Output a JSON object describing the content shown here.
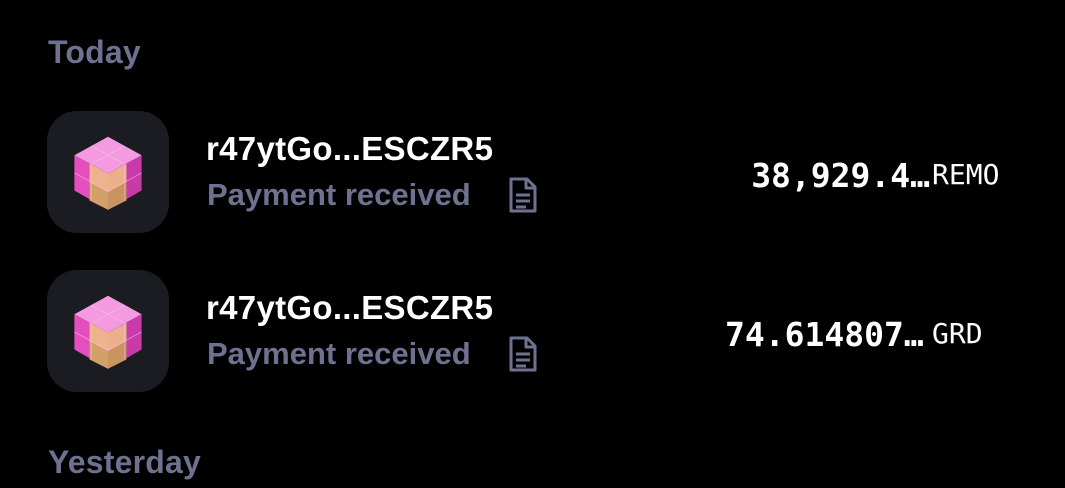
{
  "sections": {
    "today": "Today",
    "yesterday": "Yesterday"
  },
  "transactions": [
    {
      "address": "r47ytGo...ESCZR5",
      "status": "Payment received",
      "amount": "38,929.4…",
      "currency": "REMO",
      "icon": "pink-cube-token-icon"
    },
    {
      "address": "r47ytGo...ESCZR5",
      "status": "Payment received",
      "amount": "74.61480773",
      "currency": "GRD",
      "icon": "pink-cube-token-icon"
    }
  ],
  "colors": {
    "background": "#000000",
    "muted_text": "#6e7290",
    "avatar_bg": "#1b1c22",
    "cube_pink": "#e54fbd",
    "cube_gold": "#d9b072"
  }
}
